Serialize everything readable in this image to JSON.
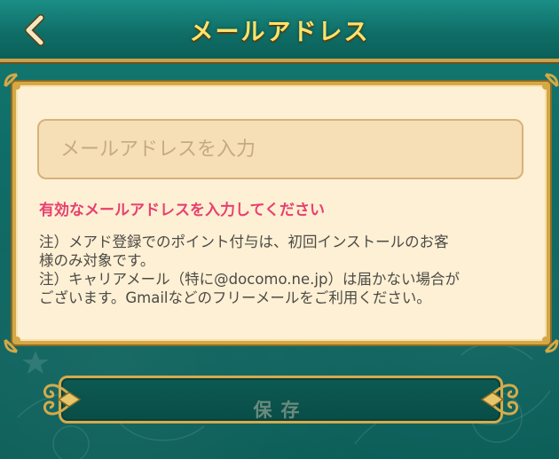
{
  "header": {
    "title": "メールアドレス",
    "back_icon": "chevron-left-icon"
  },
  "form": {
    "email_placeholder": "メールアドレスを入力",
    "email_value": "",
    "error_message": "有効なメールアドレスを入力してください",
    "note_line1": "注）メアド登録でのポイント付与は、初回インストールのお客",
    "note_line2": "様のみ対象です。",
    "note_line3": "注）キャリアメール（特に@docomo.ne.jp）は届かない場合が",
    "note_line4": "ございます。Gmailなどのフリーメールをご利用ください。"
  },
  "footer": {
    "save_label": "保存"
  },
  "colors": {
    "background": "#0f6d66",
    "title": "#ffe36a",
    "panel": "#fdf0d4",
    "gold_border": "#d4a845",
    "error": "#e8406f"
  }
}
